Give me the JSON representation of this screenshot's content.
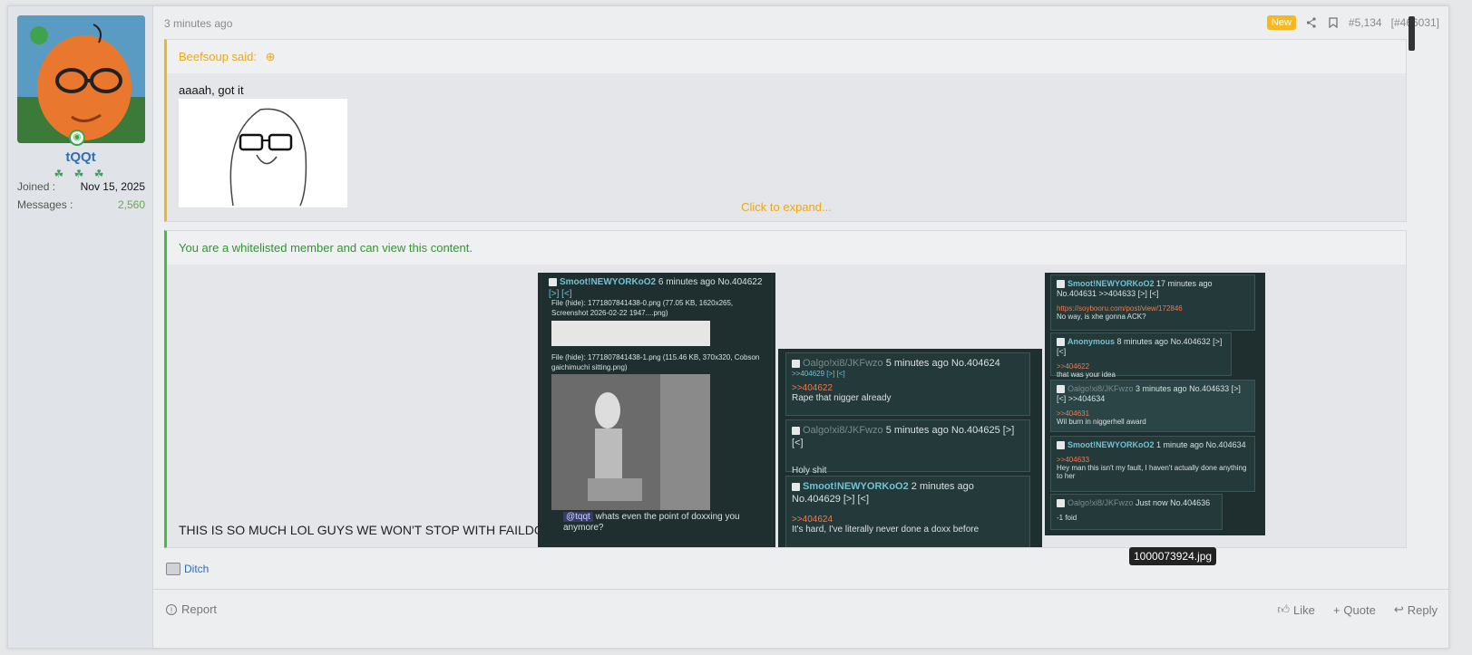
{
  "user": {
    "name": "tQQt",
    "rank_icons": "☘ ☘ ☘",
    "joined_label": "Joined :",
    "joined": "Nov 15, 2025",
    "messages_label": "Messages :",
    "messages": "2,560"
  },
  "post": {
    "time": "3 minutes ago",
    "new_badge": "New",
    "post_num": "#5,134",
    "post_id": "[#466031]"
  },
  "quote": {
    "author": "Beefsoup said:",
    "text": "aaaah, got it",
    "expand": "Click to expand..."
  },
  "whitelist": {
    "notice": "You are a whitelisted member and can view this content.",
    "caps_text": "THIS IS SO MUCH LOL GUYS WE WON'T STOP WITH FAILDOX"
  },
  "shot1": {
    "h_name": "Smoot!NEWYORKoO2",
    "h_rest": "6 minutes ago No.404622",
    "h_links": "[>] [<]",
    "file1": "File (hide): 1771807841438-0.png (77.05 KB, 1620x265, Screenshot 2026-02-22 1947....png)",
    "file2": "File (hide): 1771807841438-1.png (115.46 KB, 370x320, Cobson gaichimuchi sitting.png)",
    "mention": "@tqqt",
    "msg": "whats even the point of doxxing you anymore?"
  },
  "shot2": {
    "c1_name": "Oalgo!xi8/JKFwzo",
    "c1_time": "5 minutes ago No.404624",
    "c1_ref": ">>404629 [>] [<]",
    "c1_reply": ">>404622",
    "c1_text": "Rape that nigger already",
    "c2_name": "Oalgo!xi8/JKFwzo",
    "c2_time": "5 minutes ago No.404625 [>] [<]",
    "c2_text": "Holy shit",
    "c3_name": "Smoot!NEWYORKoO2",
    "c3_time": "2 minutes ago No.404629 [>] [<]",
    "c3_reply": ">>404624",
    "c3_text": "It's hard, I've literally never done a doxx before"
  },
  "shot3": {
    "c1_name": "Smoot!NEWYORKoO2",
    "c1_time": "17 minutes ago No.404631 >>404633 [>] [<]",
    "c1_link": "https://soybooru.com/post/view/172846",
    "c1_text": "No way, is xhe gonna ACK?",
    "c2_name": "Anonymous",
    "c2_time": "8 minutes ago No.404632 [>] [<]",
    "c2_reply": ">>404622",
    "c2_text": "that was your idea",
    "c3_name": "Oalgo!xi8/JKFwzo",
    "c3_time": "3 minutes ago No.404633 [>] [<] >>404634",
    "c3_reply": ">>404631",
    "c3_text": "Wil burn in niggerhell award",
    "c4_name": "Smoot!NEWYORKoO2",
    "c4_time": "1 minute ago No.404634",
    "c4_reply": ">>404633",
    "c4_text": "Hey man this isn't my fault, I haven't actually done anything to her",
    "c5_name": "Oalgo!xi8/JKFwzo",
    "c5_time": "Just now No.404636",
    "c5_text": "-1 foid"
  },
  "tooltip": "1000073924.jpg",
  "signature": "Ditch",
  "actions": {
    "report": "Report",
    "like": "Like",
    "quote": "Quote",
    "reply": "Reply"
  }
}
